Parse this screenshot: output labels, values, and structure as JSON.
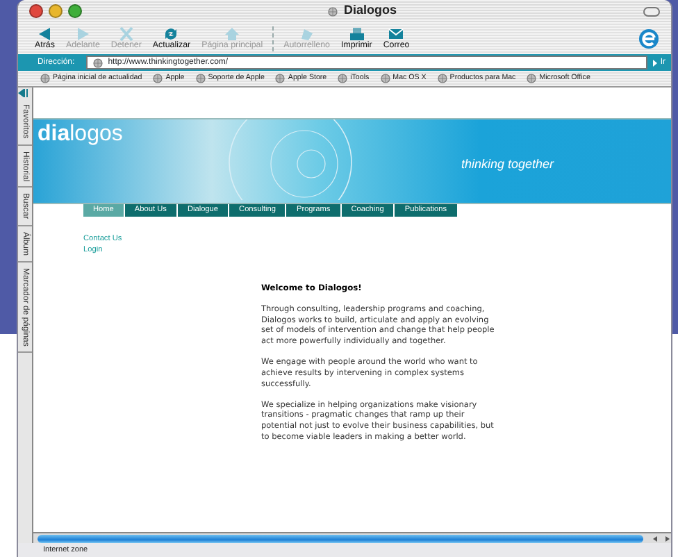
{
  "window": {
    "title": "Dialogos"
  },
  "toolbar": {
    "groups": [
      [
        {
          "label": "Atrás",
          "kind": "back",
          "disabled": false
        },
        {
          "label": "Adelante",
          "kind": "forward",
          "disabled": true
        },
        {
          "label": "Detener",
          "kind": "stop",
          "disabled": true
        },
        {
          "label": "Actualizar",
          "kind": "refresh",
          "disabled": false
        },
        {
          "label": "Página principal",
          "kind": "home",
          "disabled": true
        }
      ],
      [
        {
          "label": "Autorrelleno",
          "kind": "autofill",
          "disabled": true
        },
        {
          "label": "Imprimir",
          "kind": "print",
          "disabled": false
        },
        {
          "label": "Correo",
          "kind": "mail",
          "disabled": false
        }
      ]
    ]
  },
  "address_bar": {
    "label": "Dirección:",
    "value": "http://www.thinkingtogether.com/",
    "go_button": "Ir"
  },
  "favorites": [
    "Página inicial de actualidad",
    "Apple",
    "Soporte de Apple",
    "Apple Store",
    "iTools",
    "Mac OS X",
    "Productos para Mac",
    "Microsoft Office"
  ],
  "side_tabs": [
    "Favoritos",
    "Historial",
    "Buscar",
    "Álbum",
    "Marcador de páginas"
  ],
  "page": {
    "logo": "**dia**logos",
    "tagline": "thinking together",
    "nav": [
      {
        "label": "Home",
        "selected": true
      },
      {
        "label": "About Us",
        "selected": false
      },
      {
        "label": "Dialogue",
        "selected": false
      },
      {
        "label": "Consulting",
        "selected": false
      },
      {
        "label": "Programs",
        "selected": false
      },
      {
        "label": "Coaching",
        "selected": false
      },
      {
        "label": "Publications",
        "selected": false
      }
    ],
    "side_links": [
      "Contact Us",
      "Login"
    ],
    "heading": "Welcome to Dialogos!",
    "paragraphs": [
      "Through consulting, leadership programs and coaching, Dialogos works to build, articulate and apply an evolving set of models of intervention and change that help people act more powerfully individually and together.",
      "We engage with people around the world who want to achieve results by intervening in complex systems successfully.",
      "We specialize in helping organizations make visionary transitions - pragmatic changes that ramp up their potential not just to evolve their business capabilities, but to become viable leaders in making a better world."
    ]
  },
  "status_bar": "Internet zone"
}
